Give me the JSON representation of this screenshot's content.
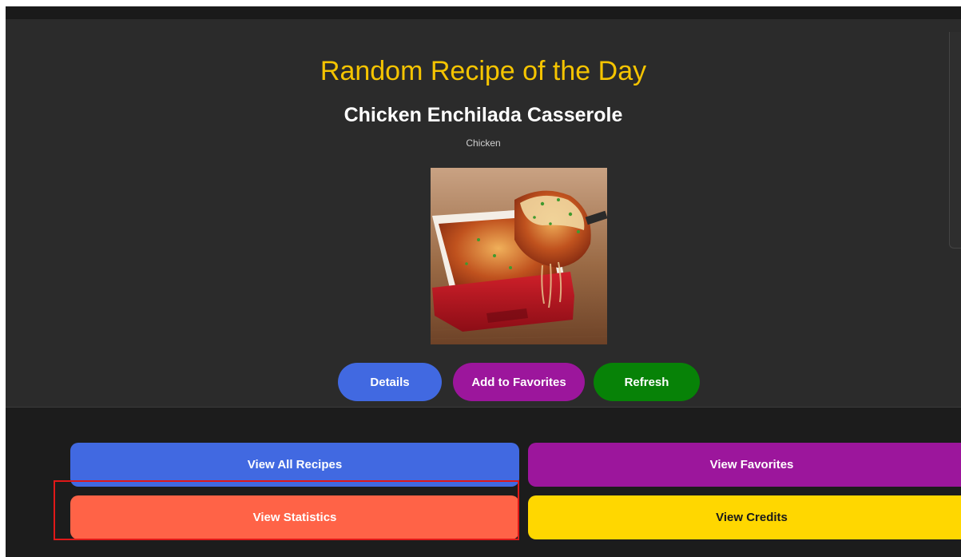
{
  "hero": {
    "title": "Random Recipe of the Day",
    "recipe_name": "Chicken Enchilada Casserole",
    "category": "Chicken",
    "image_subject": "chicken-enchilada-casserole-photo",
    "actions": {
      "details": "Details",
      "add_to_favorites": "Add to Favorites",
      "refresh": "Refresh"
    }
  },
  "nav": {
    "view_all_recipes": "View All Recipes",
    "view_favorites": "View Favorites",
    "view_statistics": "View Statistics",
    "view_credits": "View Credits"
  },
  "colors": {
    "title": "#f5c400",
    "details": "#4169e1",
    "favorites": "#9c169c",
    "refresh": "#078207",
    "statistics": "#ff6347",
    "credits": "#ffd700",
    "highlight": "#e01818"
  }
}
